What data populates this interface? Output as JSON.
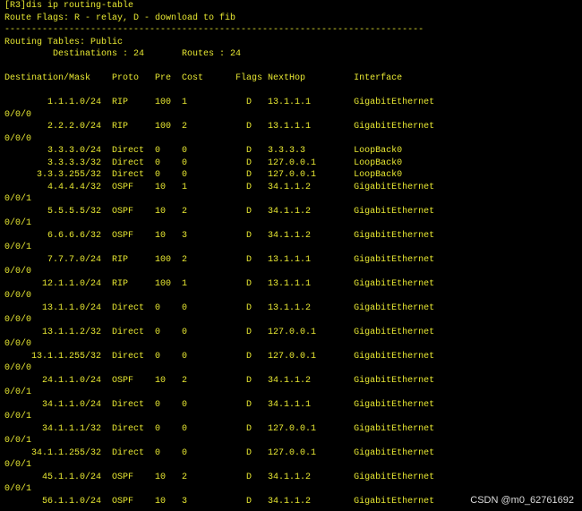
{
  "terminal": {
    "prompt_command": "[R3]dis ip routing-table",
    "route_flags": "Route Flags: R - relay, D - download to fib",
    "separator": "------------------------------------------------------------------------------",
    "routing_tables": "Routing Tables: Public",
    "summary": "         Destinations : 24       Routes : 24",
    "blank": "",
    "header": "Destination/Mask    Proto   Pre  Cost      Flags NextHop         Interface",
    "rows": [
      "        1.1.1.0/24  RIP     100  1           D   13.1.1.1        GigabitEthernet",
      "0/0/0",
      "        2.2.2.0/24  RIP     100  2           D   13.1.1.1        GigabitEthernet",
      "0/0/0",
      "        3.3.3.0/24  Direct  0    0           D   3.3.3.3         LoopBack0",
      "        3.3.3.3/32  Direct  0    0           D   127.0.0.1       LoopBack0",
      "      3.3.3.255/32  Direct  0    0           D   127.0.0.1       LoopBack0",
      "        4.4.4.4/32  OSPF    10   1           D   34.1.1.2        GigabitEthernet",
      "0/0/1",
      "        5.5.5.5/32  OSPF    10   2           D   34.1.1.2        GigabitEthernet",
      "0/0/1",
      "        6.6.6.6/32  OSPF    10   3           D   34.1.1.2        GigabitEthernet",
      "0/0/1",
      "        7.7.7.0/24  RIP     100  2           D   13.1.1.1        GigabitEthernet",
      "0/0/0",
      "       12.1.1.0/24  RIP     100  1           D   13.1.1.1        GigabitEthernet",
      "0/0/0",
      "       13.1.1.0/24  Direct  0    0           D   13.1.1.2        GigabitEthernet",
      "0/0/0",
      "       13.1.1.2/32  Direct  0    0           D   127.0.0.1       GigabitEthernet",
      "0/0/0",
      "     13.1.1.255/32  Direct  0    0           D   127.0.0.1       GigabitEthernet",
      "0/0/0",
      "       24.1.1.0/24  OSPF    10   2           D   34.1.1.2        GigabitEthernet",
      "0/0/1",
      "       34.1.1.0/24  Direct  0    0           D   34.1.1.1        GigabitEthernet",
      "0/0/1",
      "       34.1.1.1/32  Direct  0    0           D   127.0.0.1       GigabitEthernet",
      "0/0/1",
      "     34.1.1.255/32  Direct  0    0           D   127.0.0.1       GigabitEthernet",
      "0/0/1",
      "       45.1.1.0/24  OSPF    10   2           D   34.1.1.2        GigabitEthernet",
      "0/0/1",
      "       56.1.1.0/24  OSPF    10   3           D   34.1.1.2        GigabitEthernet"
    ]
  },
  "watermark": "CSDN @m0_62761692",
  "colors": {
    "background": "#000000",
    "text": "#e8e832"
  }
}
